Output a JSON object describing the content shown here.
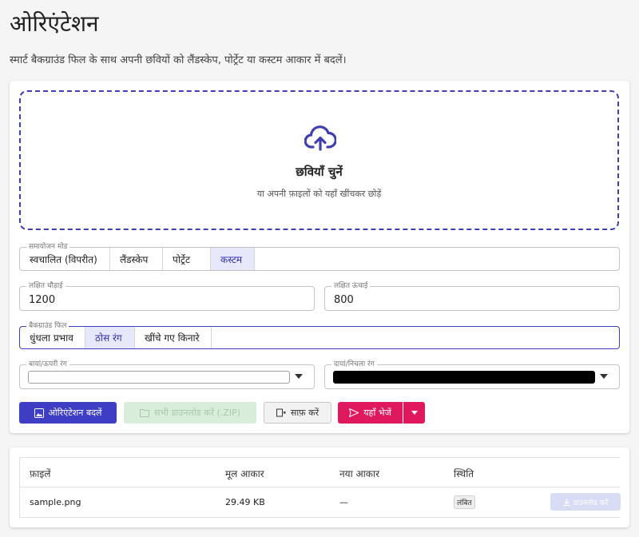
{
  "header": {
    "title": "ओरिएंटेशन",
    "subtitle": "स्मार्ट बैकग्राउंड फिल के साथ अपनी छवियों को लैंडस्केप, पोर्ट्रेट या कस्टम आकार में बदलें।"
  },
  "dropzone": {
    "icon": "cloud-upload-icon",
    "title": "छवियाँ चुनें",
    "subtitle": "या अपनी फ़ाइलों को यहाँ खींचकर छोड़ें"
  },
  "adjust_mode": {
    "legend": "समायोजन मोड",
    "options": [
      "स्वचालित (विपरीत)",
      "लैंडस्केप",
      "पोर्ट्रेट",
      "कस्टम"
    ],
    "selected": "कस्टम"
  },
  "target_width": {
    "legend": "लक्षित चौड़ाई",
    "value": "1200"
  },
  "target_height": {
    "legend": "लक्षित ऊंचाई",
    "value": "800"
  },
  "background_fill": {
    "legend": "बैकग्राउंड फिल",
    "options": [
      "धुंधला प्रभाव",
      "ठोस रंग",
      "खींचे गए किनारे"
    ],
    "selected": "ठोस रंग"
  },
  "color_left": {
    "legend": "बायां/ऊपरी रंग",
    "color": "#ffffff"
  },
  "color_right": {
    "legend": "दायां/निचला रंग",
    "color": "#000000"
  },
  "actions": {
    "convert": "ओरिएंटेशन बदलें",
    "download_all": "सभी डाउनलोड करें (.ZIP)",
    "clear": "साफ़ करें",
    "send": "यहाँ भेजें"
  },
  "table": {
    "headers": [
      "फ़ाइलें",
      "मूल आकार",
      "नया आकार",
      "स्थिति"
    ],
    "rows": [
      {
        "file": "sample.png",
        "original": "29.49 KB",
        "new": "—",
        "status": "लंबित",
        "download": "डाउनलोड करें"
      }
    ]
  },
  "colors": {
    "accent": "#3d3dc6",
    "pink": "#e0195e",
    "dashed_border": "#3f3fb0"
  }
}
